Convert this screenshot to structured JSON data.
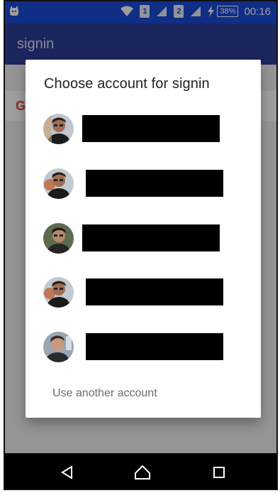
{
  "status_bar": {
    "time": "00:16",
    "battery": "38%",
    "sim1": "1",
    "sim2": "2"
  },
  "app_bar": {
    "title": "signin"
  },
  "background": {
    "google_letter": "G"
  },
  "dialog": {
    "title": "Choose account for signin",
    "use_another": "Use another account"
  },
  "colors": {
    "status_bar": "#1b4bd8",
    "app_bar": "#2c3e9a",
    "google_red": "#ea4335",
    "redaction": "#000000"
  },
  "icons": [
    "app-notification-icon",
    "wifi-icon",
    "signal-icon",
    "charging-icon",
    "back-icon",
    "home-icon",
    "recents-icon"
  ]
}
